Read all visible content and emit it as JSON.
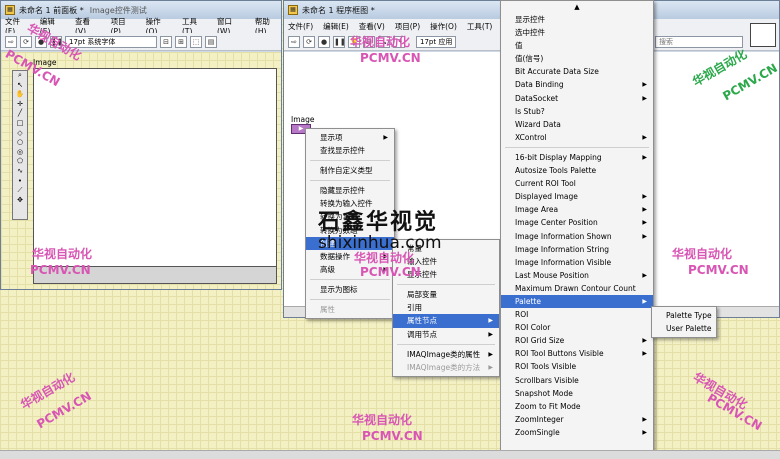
{
  "front_panel": {
    "title": "未命名 1 前面板 *",
    "title_suffix": "Image控件测试",
    "menu": [
      "文件(F)",
      "编辑(E)",
      "查看(V)",
      "项目(P)",
      "操作(O)",
      "工具(T)",
      "窗口(W)",
      "帮助(H)"
    ],
    "font_selector": "17pt 系统字体",
    "image_label": "Image"
  },
  "block_diagram": {
    "title": "未命名 1 程序框图 *",
    "menu": [
      "文件(F)",
      "编辑(E)",
      "查看(V)",
      "项目(P)",
      "操作(O)",
      "工具(T)"
    ],
    "font_selector": "17pt 应用",
    "search_placeholder": "搜索",
    "image_label": "Image"
  },
  "context_menu": {
    "items": [
      {
        "label": "显示项",
        "sub": true
      },
      {
        "label": "查找显示控件"
      },
      {
        "sep": true
      },
      {
        "label": "制作自定义类型"
      },
      {
        "sep": true
      },
      {
        "label": "隐藏显示控件"
      },
      {
        "label": "转换为输入控件"
      },
      {
        "label": "转换为常量"
      },
      {
        "label": "转换为数组"
      },
      {
        "label": "创建",
        "hl": true
      },
      {
        "label": "数据操作",
        "sub": true
      },
      {
        "label": "高级",
        "sub": true
      },
      {
        "sep": true
      },
      {
        "label": "显示为图标"
      },
      {
        "sep": true
      },
      {
        "label": "属性",
        "dis": true
      }
    ]
  },
  "create_menu": {
    "items": [
      {
        "label": "常量"
      },
      {
        "label": "输入控件"
      },
      {
        "label": "显示控件"
      },
      {
        "sep": true
      },
      {
        "label": "局部变量"
      },
      {
        "label": "引用"
      },
      {
        "label": "属性节点",
        "sub": true,
        "hl": true
      },
      {
        "label": "调用节点",
        "sub": true
      },
      {
        "sep": true
      },
      {
        "label": "IMAQImage类的属性",
        "sub": true
      },
      {
        "label": "IMAQImage类的方法",
        "sub": true,
        "dis": true
      }
    ]
  },
  "property_menu": {
    "scroll_up": "▲",
    "items": [
      {
        "label": "显示控件"
      },
      {
        "label": "选中控件"
      },
      {
        "label": "值"
      },
      {
        "label": "值(信号)"
      },
      {
        "label": "Bit Accurate Data Size"
      },
      {
        "label": "Data Binding",
        "sub": true
      },
      {
        "label": "DataSocket",
        "sub": true
      },
      {
        "label": "Is Stub?"
      },
      {
        "label": "Wizard Data"
      },
      {
        "label": "XControl",
        "sub": true
      },
      {
        "sep": true
      },
      {
        "label": "16-bit Display Mapping",
        "sub": true
      },
      {
        "label": "Autosize Tools Palette"
      },
      {
        "label": "Current ROI Tool"
      },
      {
        "label": "Displayed Image",
        "sub": true
      },
      {
        "label": "Image Area",
        "sub": true
      },
      {
        "label": "Image Center Position",
        "sub": true
      },
      {
        "label": "Image Information Shown",
        "sub": true
      },
      {
        "label": "Image Information String"
      },
      {
        "label": "Image Information Visible"
      },
      {
        "label": "Last Mouse Position",
        "sub": true
      },
      {
        "label": "Maximum Drawn Contour Count"
      },
      {
        "label": "Palette",
        "sub": true,
        "hl": true
      },
      {
        "label": "ROI"
      },
      {
        "label": "ROI Color"
      },
      {
        "label": "ROI Grid Size",
        "sub": true
      },
      {
        "label": "ROI Tool Buttons Visible",
        "sub": true
      },
      {
        "label": "ROI Tools Visible"
      },
      {
        "label": "Scrollbars Visible"
      },
      {
        "label": "Snapshot Mode"
      },
      {
        "label": "Zoom to Fit Mode"
      },
      {
        "label": "ZoomInteger",
        "sub": true
      },
      {
        "label": "ZoomSingle",
        "sub": true
      }
    ]
  },
  "palette_menu": {
    "items": [
      {
        "label": "Palette Type"
      },
      {
        "label": "User Palette"
      }
    ]
  },
  "watermarks": {
    "cn": "华视自动化",
    "en": "PCMV.CN",
    "site": "shixinhua.com",
    "logo": "石鑫华视觉"
  },
  "colors": {
    "highlight": "#3a6fd0",
    "watermark_pink": "#d855b4",
    "watermark_green": "#2aa84a"
  }
}
